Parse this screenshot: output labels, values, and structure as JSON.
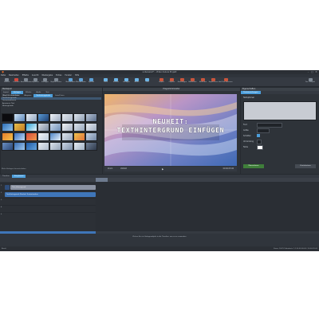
{
  "window": {
    "title": "unbenannt* - Video deluxe Projekt",
    "controls": [
      "–",
      "□",
      "✕"
    ]
  },
  "menu": [
    "Datei",
    "Bearbeiten",
    "Effekte",
    "Ansicht",
    "Wiedergabe",
    "Extras",
    "Fenster",
    "Hilfe"
  ],
  "toolbar": {
    "left": [
      "Zurück",
      "Löschen",
      "Ausschneiden",
      "Kopieren",
      "Einfügen",
      "Objekte teilen"
    ],
    "middle": [
      "Mausmodus",
      "Überblenden",
      "Spezial"
    ],
    "center": [
      "Texte",
      "Effekte",
      "Vorlagen",
      "Audio",
      "Titel"
    ],
    "right": [
      "Import",
      "Objekte",
      "Hinzufügen",
      "Bibliothek",
      "Multicam",
      "Exportieren",
      "Auf Disc brennen"
    ],
    "far_right": "Ton / Projekt"
  },
  "media_pool": {
    "header": "Mediapool",
    "tabs": [
      "Import",
      "Vorlagen",
      "Effekte",
      "Audio",
      "Text"
    ],
    "subtabs": [
      "Titel",
      "Untertitel",
      "Abspann",
      "Texthintergründe",
      "Intro/Outro"
    ],
    "tree": [
      "Neu: Effekte & Texte",
      "Texthintergründe",
      "Textanimationen",
      "Animierte Titel",
      "Hintergründe"
    ],
    "footer": "Mehr Vorlagen herunterladen"
  },
  "preview": {
    "header": "Programmmonitor",
    "line1": "NEUHEIT:",
    "line2": "TEXTHINTERGRUND EINFÜGEN",
    "controls": [
      "Zoom",
      "Vollbild"
    ],
    "timecode": "00:00:05:06"
  },
  "properties": {
    "header": "Eigenschaften",
    "tab": "Titeleinstellungen",
    "section": "Textoptionen",
    "labels": [
      "Font",
      "Größe",
      "Schatten",
      "Umrandung",
      "Farbe"
    ],
    "buttons": [
      "Übernehmen",
      "Zurücksetzen"
    ]
  },
  "timeline": {
    "tabs": [
      "Timeline",
      "Storyboard"
    ],
    "tracks": [
      "1",
      "2",
      "3",
      "4",
      "5"
    ],
    "clip1": "Titel_Hintergrund",
    "clip2": "Texthintergrund: Neuheit Textanimation",
    "hint": "Ziehen Sie ein Vorlagenobjekt in die Timeline, um es zu verwenden"
  },
  "status": {
    "left": "Bereit",
    "right": "Zoom: 100%   Videokarte 1:1   00:00:00:00 / 00:00:59:00"
  },
  "colors": {
    "accent": "#4d9fdc",
    "clip_blue": "#3f76b9",
    "title_clip": "#8c93a3"
  }
}
